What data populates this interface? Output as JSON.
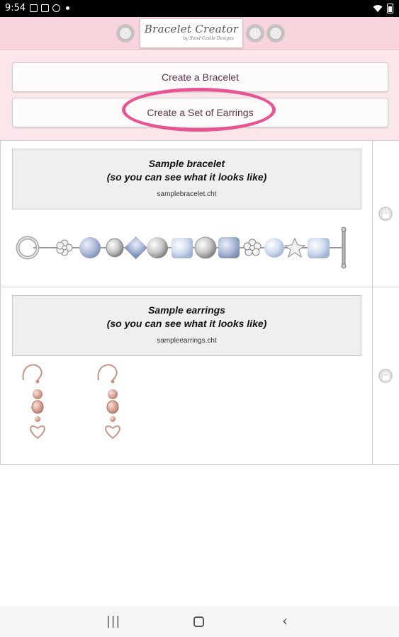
{
  "status_bar": {
    "time": "9:54"
  },
  "header": {
    "logo_title": "Bracelet Creator",
    "logo_subtitle": "by Sand Castle Designs"
  },
  "actions": {
    "create_bracelet": "Create a Bracelet",
    "create_earrings": "Create a Set of Earrings"
  },
  "items": [
    {
      "title_line1": "Sample bracelet",
      "title_line2": "(so you can see what it looks like)",
      "file": "samplebracelet.cht"
    },
    {
      "title_line1": "Sample earrings",
      "title_line2": "(so you can see what it looks like)",
      "file": "sampleearrings.cht"
    }
  ],
  "colors": {
    "header_bg": "#f8d4dc",
    "action_area_bg": "#fbe7ea",
    "highlight": "#e95593",
    "button_text": "#5d3548"
  },
  "icons": {
    "header_left": "undo-icon",
    "header_right": [
      "info-icon",
      "close-icon"
    ],
    "row": "lock-icon",
    "nav": [
      "recents-icon",
      "home-icon",
      "back-icon"
    ]
  }
}
